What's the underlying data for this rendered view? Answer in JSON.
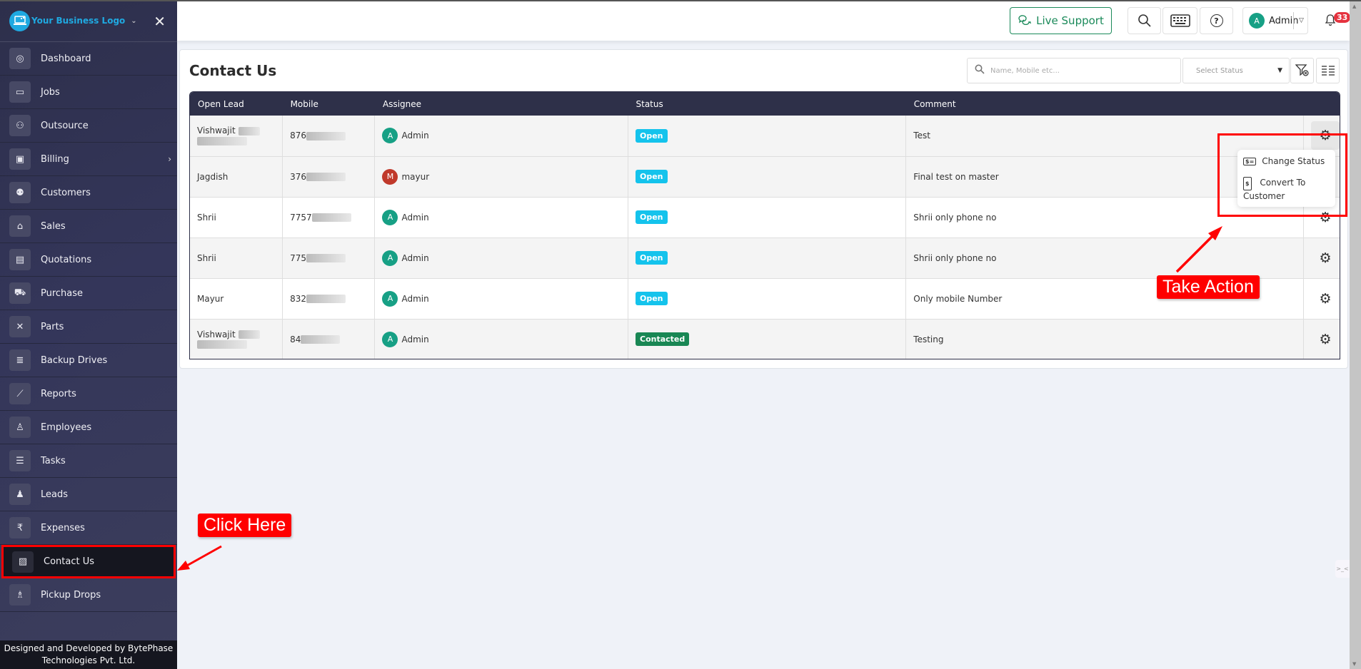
{
  "brand": {
    "name": "Your Business Logo",
    "logo_icon": "laptop-logo-icon",
    "dropdown_icon": "chevron-down-icon",
    "close_icon": "close-icon"
  },
  "sidebar": {
    "items": [
      {
        "label": "Dashboard",
        "icon": "dashboard-gauge-icon",
        "glyph": "◎"
      },
      {
        "label": "Jobs",
        "icon": "ticket-icon",
        "glyph": "▭"
      },
      {
        "label": "Outsource",
        "icon": "people-handshake-icon",
        "glyph": "⚇"
      },
      {
        "label": "Billing",
        "icon": "wallet-icon",
        "glyph": "▣",
        "has_submenu": true
      },
      {
        "label": "Customers",
        "icon": "users-group-icon",
        "glyph": "⚉"
      },
      {
        "label": "Sales",
        "icon": "store-icon",
        "glyph": "⌂"
      },
      {
        "label": "Quotations",
        "icon": "document-icon",
        "glyph": "▤"
      },
      {
        "label": "Purchase",
        "icon": "cart-icon",
        "glyph": "⛟"
      },
      {
        "label": "Parts",
        "icon": "tools-icon",
        "glyph": "✕"
      },
      {
        "label": "Backup Drives",
        "icon": "database-icon",
        "glyph": "≣"
      },
      {
        "label": "Reports",
        "icon": "line-chart-icon",
        "glyph": "⟋"
      },
      {
        "label": "Employees",
        "icon": "employee-icon",
        "glyph": "♙"
      },
      {
        "label": "Tasks",
        "icon": "checklist-icon",
        "glyph": "☰"
      },
      {
        "label": "Leads",
        "icon": "user-plus-icon",
        "glyph": "♟"
      },
      {
        "label": "Expenses",
        "icon": "rupee-icon",
        "glyph": "₹"
      },
      {
        "label": "Contact Us",
        "icon": "contact-card-icon",
        "glyph": "▨",
        "active": true
      },
      {
        "label": "Pickup Drops",
        "icon": "pickup-person-icon",
        "glyph": "♗"
      }
    ],
    "submenu_arrow": "›",
    "footer": "Designed and Developed by BytePhase Technologies Pvt. Ltd."
  },
  "header": {
    "live_support": "Live Support",
    "user": {
      "initial": "A",
      "name": "Admin"
    },
    "notifications_count": "33"
  },
  "page": {
    "title": "Contact Us",
    "search_placeholder": "Name, Mobile etc...",
    "status_select_placeholder": "Select Status"
  },
  "table": {
    "columns": [
      "Open Lead",
      "Mobile",
      "Assignee",
      "Status",
      "Comment",
      ""
    ],
    "rows": [
      {
        "lead": "Vishwajit",
        "lead_redacted": true,
        "mobile": "876",
        "assignee_initial": "A",
        "assignee": "Admin",
        "assignee_color": "#17a085",
        "status": "Open",
        "comment": "Test"
      },
      {
        "lead": "Jagdish",
        "lead_redacted": false,
        "mobile": "376",
        "assignee_initial": "M",
        "assignee": "mayur",
        "assignee_color": "#c0392b",
        "status": "Open",
        "comment": "Final test on master"
      },
      {
        "lead": "Shrii",
        "lead_redacted": false,
        "mobile": "7757",
        "assignee_initial": "A",
        "assignee": "Admin",
        "assignee_color": "#17a085",
        "status": "Open",
        "comment": "Shrii only phone no"
      },
      {
        "lead": "Shrii",
        "lead_redacted": false,
        "mobile": "775",
        "assignee_initial": "A",
        "assignee": "Admin",
        "assignee_color": "#17a085",
        "status": "Open",
        "comment": "Shrii only phone no"
      },
      {
        "lead": "Mayur",
        "lead_redacted": false,
        "mobile": "832",
        "assignee_initial": "A",
        "assignee": "Admin",
        "assignee_color": "#17a085",
        "status": "Open",
        "comment": "Only mobile Number"
      },
      {
        "lead": "Vishwajit",
        "lead_redacted": true,
        "mobile": "84",
        "assignee_initial": "A",
        "assignee": "Admin",
        "assignee_color": "#17a085",
        "status": "Contacted",
        "comment": "Testing"
      }
    ],
    "status_colors": {
      "Open": "#14c3ec",
      "Contacted": "#198754"
    }
  },
  "action_menu": {
    "items": [
      {
        "label": "Change Status",
        "icon": "status-card-icon"
      },
      {
        "label": "Convert To Customer",
        "icon": "invoice-dollar-icon"
      }
    ]
  },
  "annotations": {
    "click_here": "Click Here",
    "take_action": "Take Action"
  }
}
